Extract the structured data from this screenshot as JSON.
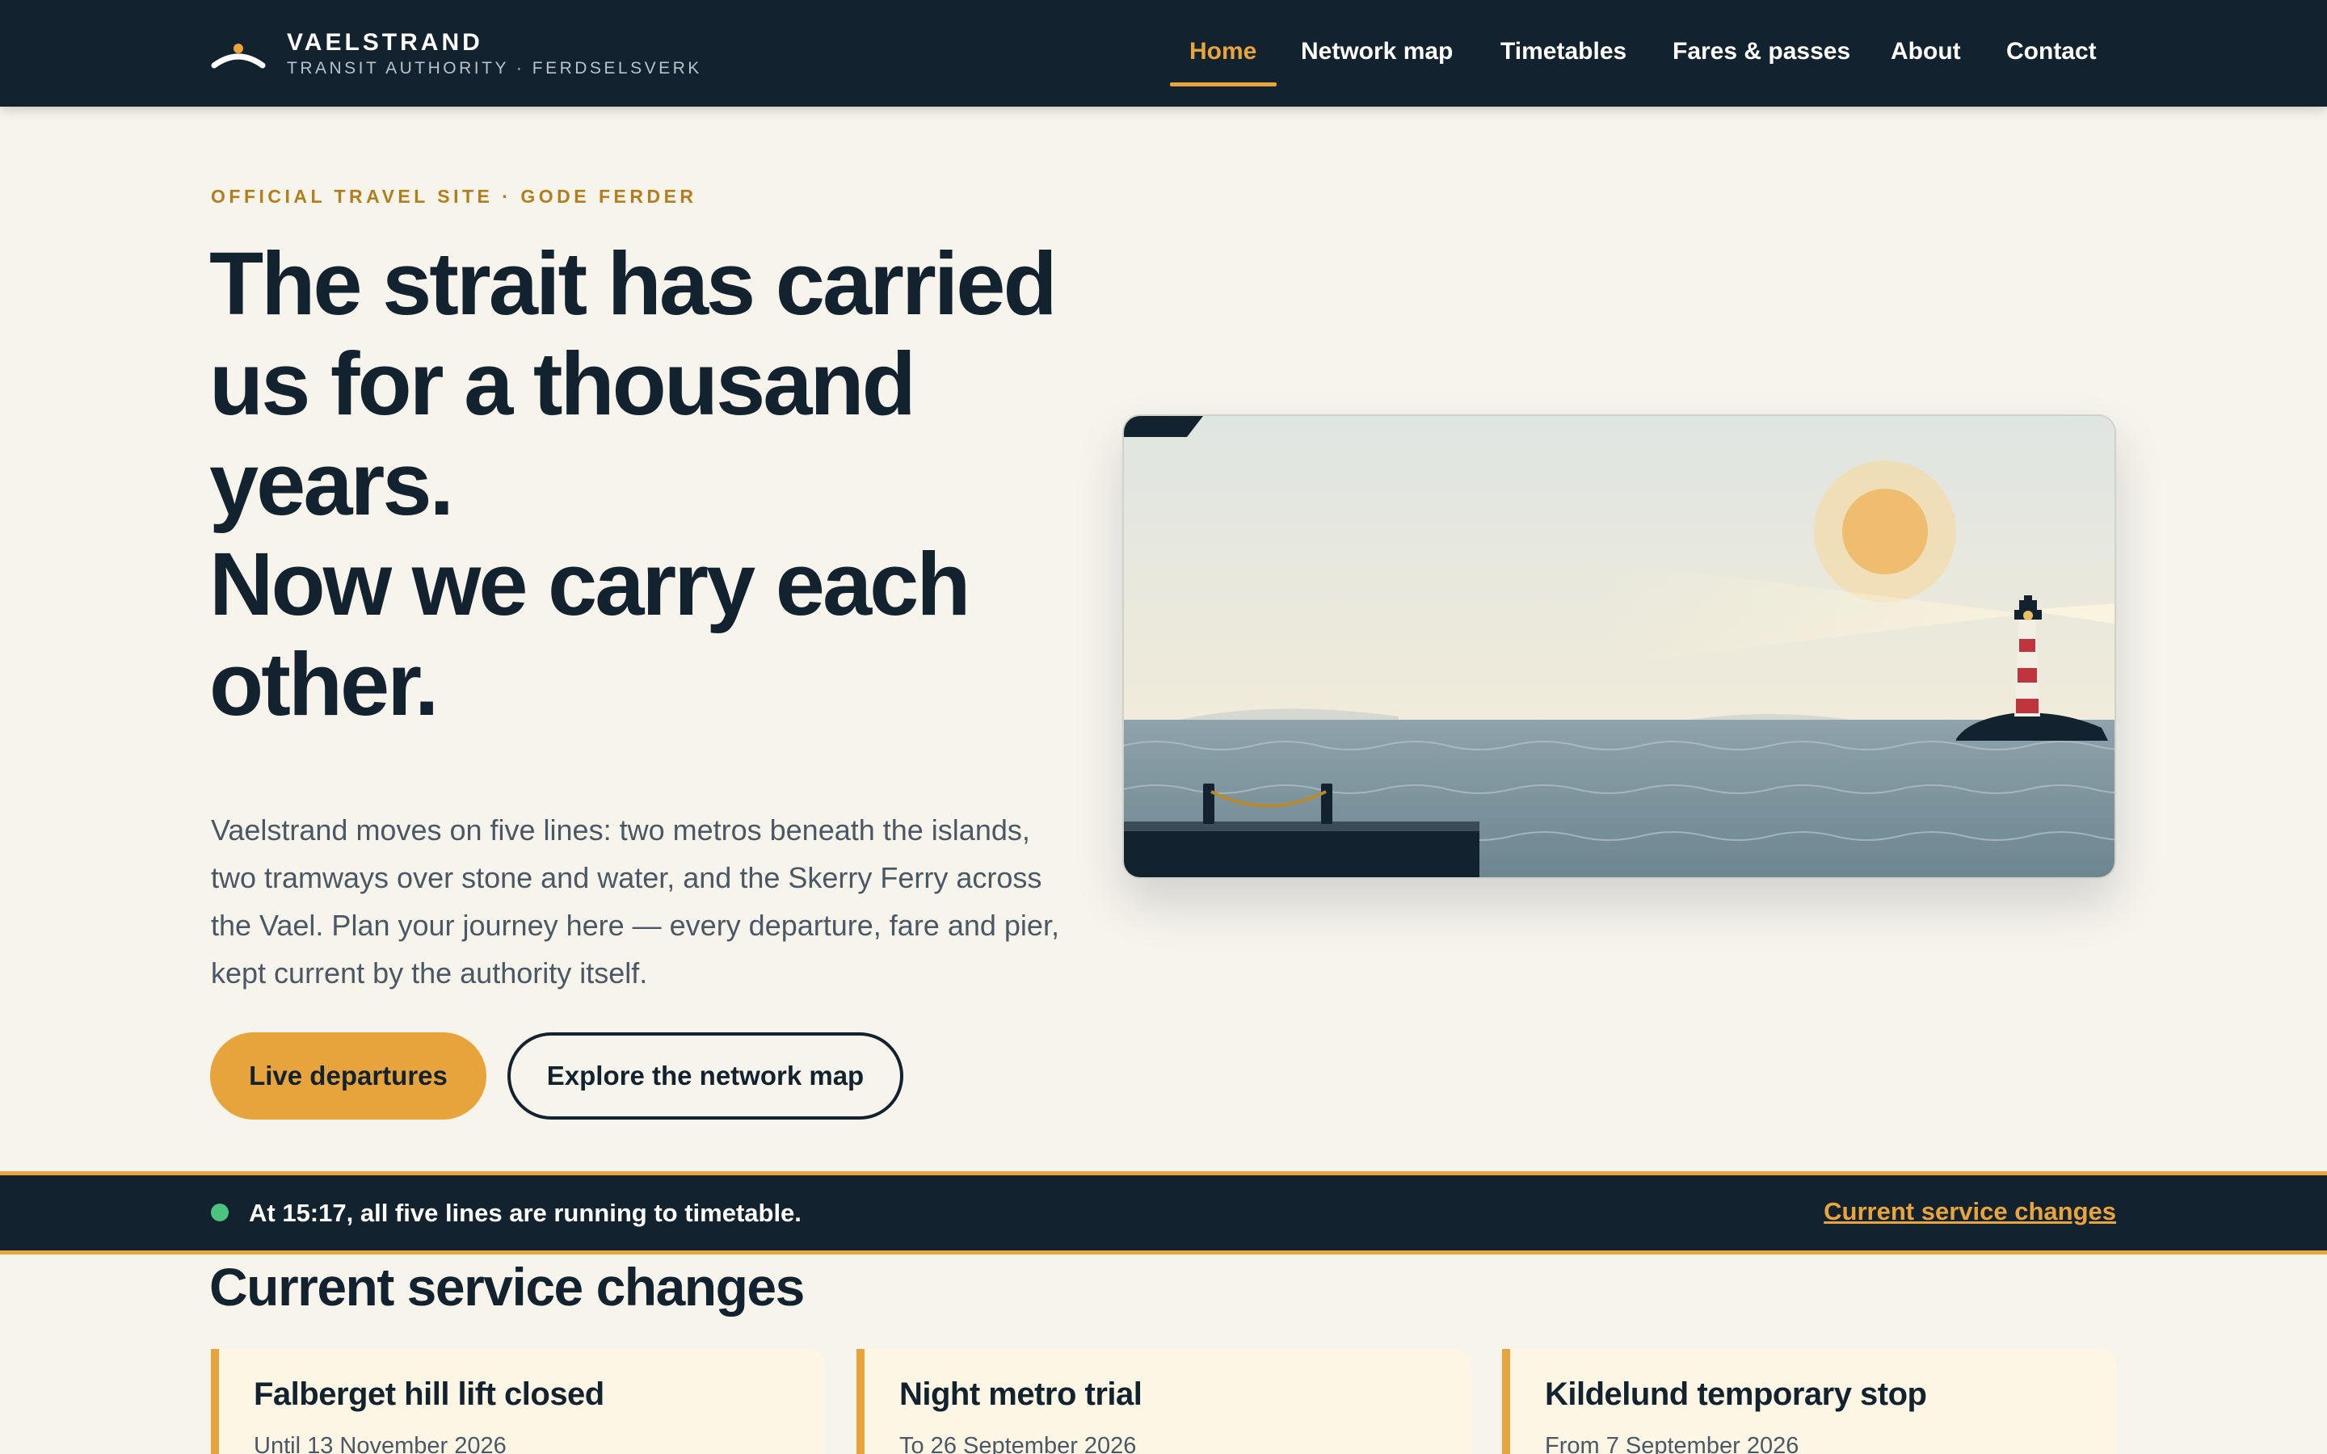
{
  "brand": {
    "name": "VAELSTRAND",
    "subtitle": "TRANSIT AUTHORITY · FERDSELSVERK",
    "logo_icon": "sunrise-arc-icon"
  },
  "nav": [
    {
      "label": "Home",
      "active": true
    },
    {
      "label": "Network map",
      "active": false
    },
    {
      "label": "Timetables",
      "active": false
    },
    {
      "label": "Fares & passes",
      "active": false
    },
    {
      "label": "About",
      "active": false
    },
    {
      "label": "Contact",
      "active": false
    }
  ],
  "hero": {
    "eyebrow": "OFFICIAL TRAVEL SITE · GODE FERDER",
    "title_lines": [
      "The strait has carried",
      "us for a thousand",
      "years.",
      "Now we carry each",
      "other."
    ],
    "body": "Vaelstrand moves on five lines: two metros beneath the islands, two tramways over stone and water, and the Skerry Ferry across the Vael. Plan your journey here — every departure, fare and pier, kept current by the authority itself.",
    "primary_cta": "Live departures",
    "secondary_cta": "Explore the network map",
    "illustration": "strait-lighthouse-illustration"
  },
  "status": {
    "message": "At 15:17, all five lines are running to timetable.",
    "link": "Current service changes",
    "state_color": "#4cc37f"
  },
  "service_changes": {
    "title": "Current service changes",
    "cards": [
      {
        "title": "Falberget hill lift closed",
        "meta": "Until 13 November 2026"
      },
      {
        "title": "Night metro trial",
        "meta": "To 26 September 2026"
      },
      {
        "title": "Kildelund temporary stop",
        "meta": "From 7 September 2026"
      }
    ]
  },
  "colors": {
    "navy": "#13222f",
    "accent": "#e9a53c",
    "background": "#f7f4ec",
    "card": "#fdf6e5"
  }
}
